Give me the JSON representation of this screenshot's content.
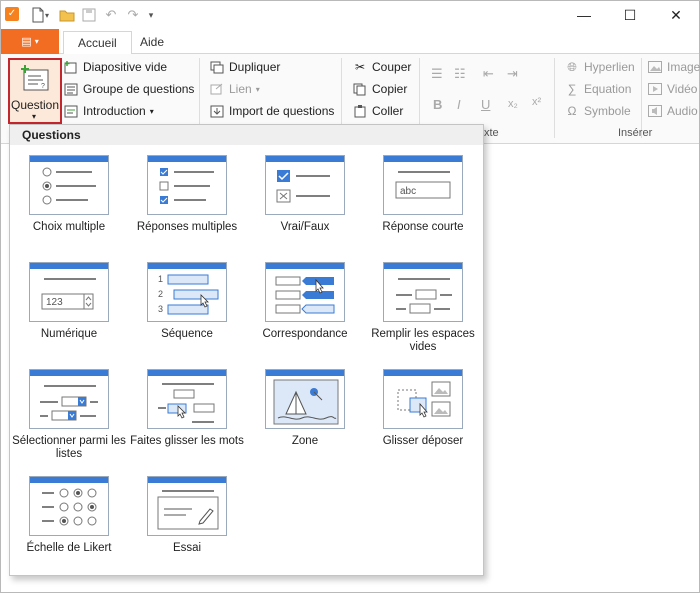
{
  "titlebar": {
    "minimize": "—",
    "maximize": "☐",
    "close": "✕"
  },
  "tabs": {
    "active": "Accueil",
    "other": "Aide"
  },
  "ribbon": {
    "question": "Question",
    "diapositive_vide": "Diapositive vide",
    "groupe_questions": "Groupe de questions",
    "introduction": "Introduction",
    "dupliquer": "Dupliquer",
    "lien": "Lien",
    "import_questions": "Import de questions",
    "couper": "Couper",
    "copier": "Copier",
    "coller": "Coller",
    "hyperlien": "Hyperlien",
    "equation": "Equation",
    "symbole": "Symbole",
    "image": "Image",
    "video": "Vidéo",
    "audio": "Audio",
    "group_texte": "xte",
    "group_inserer": "Insérer"
  },
  "dropdown": {
    "title": "Questions",
    "items": [
      {
        "label": "Choix multiple",
        "icon": "multiple-choice-icon"
      },
      {
        "label": "Réponses multiples",
        "icon": "multiple-response-icon"
      },
      {
        "label": "Vrai/Faux",
        "icon": "true-false-icon"
      },
      {
        "label": "Réponse courte",
        "icon": "short-answer-icon",
        "sample": "abc"
      },
      {
        "label": "Numérique",
        "icon": "numeric-icon",
        "sample": "123"
      },
      {
        "label": "Séquence",
        "icon": "sequence-icon"
      },
      {
        "label": "Correspondance",
        "icon": "matching-icon"
      },
      {
        "label": "Remplir les espaces vides",
        "icon": "fill-blanks-icon"
      },
      {
        "label": "Sélectionner parmi les listes",
        "icon": "select-lists-icon"
      },
      {
        "label": "Faites glisser les mots",
        "icon": "drag-words-icon"
      },
      {
        "label": "Zone",
        "icon": "hotspot-icon"
      },
      {
        "label": "Glisser déposer",
        "icon": "drag-drop-icon"
      },
      {
        "label": "Échelle de Likert",
        "icon": "likert-icon"
      },
      {
        "label": "Essai",
        "icon": "essay-icon"
      }
    ]
  },
  "colors": {
    "accent_orange": "#f26d21",
    "card_bar_blue": "#3a7bd5",
    "highlight_red": "#c1272d"
  }
}
